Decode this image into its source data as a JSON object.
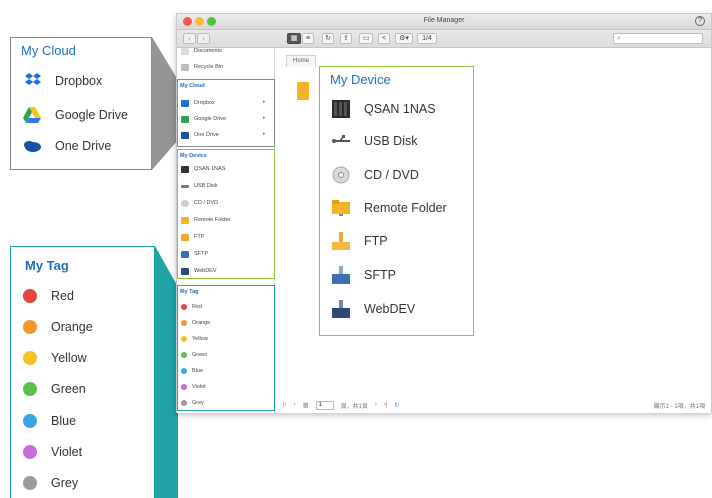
{
  "window": {
    "title": "File Manager",
    "help": "?",
    "nav_back": "‹",
    "nav_forward": "›",
    "search_icon": "search-icon",
    "toolbar_view_label": "1/4",
    "home_tab": "Home"
  },
  "sidebar": {
    "top_items": [
      {
        "label": "Documents",
        "icon": "document-icon"
      },
      {
        "label": "Recycle Bin",
        "icon": "trash-icon"
      }
    ],
    "my_cloud": {
      "heading": "My Cloud",
      "items": [
        {
          "label": "Dropbox",
          "icon": "dropbox-icon",
          "color": "#1f6fd6"
        },
        {
          "label": "Google Drive",
          "icon": "google-drive-icon",
          "color": "#2ea44f"
        },
        {
          "label": "One Drive",
          "icon": "onedrive-icon",
          "color": "#1b4fa8"
        }
      ]
    },
    "my_device": {
      "heading": "My Device",
      "items": [
        {
          "label": "QSAN 1NAS",
          "icon": "nas-icon"
        },
        {
          "label": "USB Disk",
          "icon": "usb-icon"
        },
        {
          "label": "CD / DVD",
          "icon": "cd-icon"
        },
        {
          "label": "Remote Folder",
          "icon": "folder-icon"
        },
        {
          "label": "FTP",
          "icon": "ftp-icon"
        },
        {
          "label": "SFTP",
          "icon": "sftp-icon"
        },
        {
          "label": "WebDEV",
          "icon": "webdav-icon"
        }
      ]
    },
    "my_tag": {
      "heading": "My Tag",
      "items": [
        {
          "label": "Red",
          "color": "#e8443e"
        },
        {
          "label": "Orange",
          "color": "#f4962b"
        },
        {
          "label": "Yellow",
          "color": "#f3c325"
        },
        {
          "label": "Green",
          "color": "#5cbf4c"
        },
        {
          "label": "Blue",
          "color": "#3aa5e6"
        },
        {
          "label": "Violet",
          "color": "#c86ed8"
        },
        {
          "label": "Grey",
          "color": "#9a9a9a"
        }
      ]
    }
  },
  "statusbar": {
    "page_input": "1",
    "page_text_left": "第",
    "page_text_right": "頁，共1頁",
    "summary": "顯示1 - 1項，共1項"
  },
  "colors": {
    "cloud_callout_border": "#8a8a8a",
    "device_callout_border": "#8cc63f",
    "tag_callout_border": "#1fa3a3",
    "heading_blue": "#1b6fbf"
  }
}
